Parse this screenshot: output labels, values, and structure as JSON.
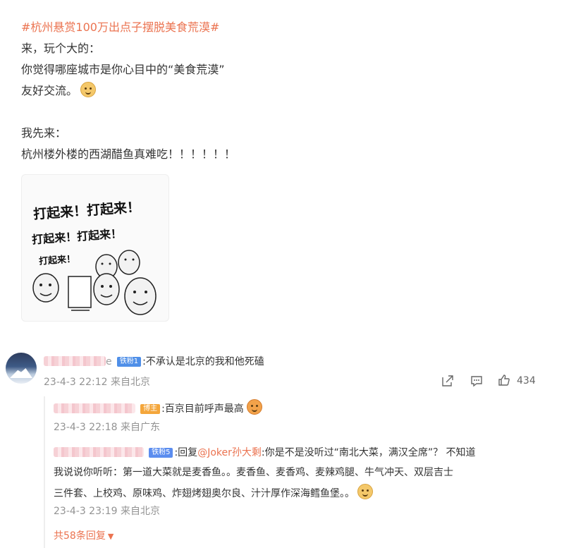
{
  "post": {
    "hashtag": "#杭州悬赏100万出点子摆脱美食荒漠#",
    "line1": "来，玩个大的：",
    "line2": "你觉得哪座城市是你心目中的“美食荒漠”",
    "line3": "友好交流。",
    "line4": "我先来：",
    "line5": "杭州楼外楼的西湖醋鱼真难吃！！！！！！",
    "meme_text_1": "打起来！打起来！",
    "meme_text_2": "打起来！打起来！",
    "meme_text_3": "打起来！"
  },
  "comment": {
    "username_tail": "e",
    "fan_badge": "铁粉1",
    "text": ":不承认是北京的我和他死磕",
    "time": "23-4-3 22:12 来自北京",
    "like_count": "434"
  },
  "replies": [
    {
      "badge": "博主",
      "text": ":百京目前呼声最高",
      "time": "23-4-3 22:18 来自广东"
    },
    {
      "badge": "铁粉5",
      "prefix": ":回复",
      "mention": "@Joker孙大剩",
      "text_line1": ":你是不是没听过“南北大菜，满汉全席”？ 不知道",
      "text_line2": "我说说你听听：第一道大菜就是麦香鱼。。麦香鱼、麦香鸡、麦辣鸡腿、牛气冲天、双层吉士",
      "text_line3": "三件套、上校鸡、原味鸡、炸翅烤翅奥尔良、汁汁厚作深海鳕鱼堡。。",
      "time": "23-4-3 23:19 来自北京"
    }
  ],
  "more_replies": "共58条回复"
}
